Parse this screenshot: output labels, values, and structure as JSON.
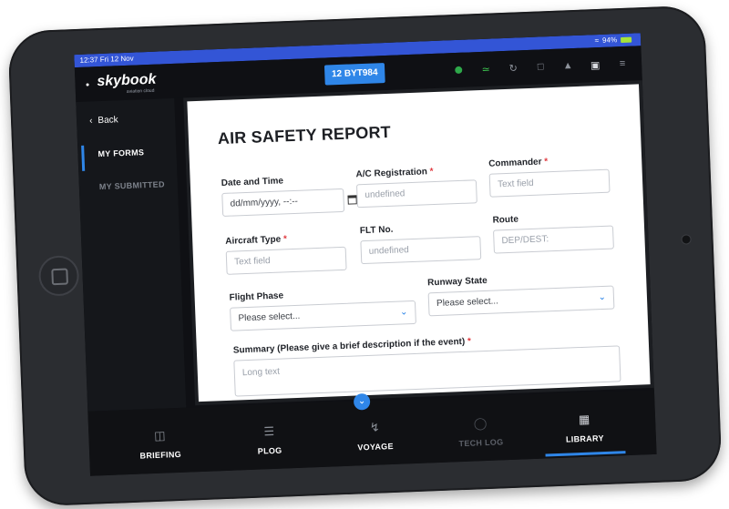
{
  "status_bar": {
    "time": "12:37",
    "date": "Fri 12 Nov",
    "battery": "94%"
  },
  "header": {
    "logo": "skybook",
    "logo_subtitle": "aviation cloud",
    "flight_button": "12 BYT984"
  },
  "sidebar": {
    "back_label": "Back",
    "items": [
      {
        "label": "MY FORMS",
        "active": true
      },
      {
        "label": "MY SUBMITTED",
        "active": false
      }
    ]
  },
  "form": {
    "title": "AIR SAFETY REPORT",
    "date_time": {
      "label": "Date and Time",
      "value": "dd/mm/yyyy, --:--"
    },
    "ac_registration": {
      "label": "A/C Registration",
      "required": "*",
      "value": "undefined"
    },
    "commander": {
      "label": "Commander",
      "required": "*",
      "placeholder": "Text field"
    },
    "aircraft_type": {
      "label": "Aircraft Type",
      "required": "*",
      "placeholder": "Text field"
    },
    "flt_no": {
      "label": "FLT No.",
      "value": "undefined"
    },
    "route": {
      "label": "Route",
      "placeholder": "DEP/DEST:"
    },
    "flight_phase": {
      "label": "Flight Phase",
      "value": "Please select..."
    },
    "runway_state": {
      "label": "Runway State",
      "value": "Please select..."
    },
    "summary": {
      "label": "Summary (Please give a brief description if the event)",
      "required": "*",
      "placeholder": "Long text"
    }
  },
  "bottom_nav": {
    "tabs": [
      {
        "label": "BRIEFING",
        "icon": "briefing-icon"
      },
      {
        "label": "PLOG",
        "icon": "checklist-icon"
      },
      {
        "label": "VOYAGE",
        "icon": "route-icon"
      },
      {
        "label": "TECH LOG",
        "icon": "engine-icon",
        "disabled": true
      },
      {
        "label": "LIBRARY",
        "icon": "library-icon",
        "active": true
      }
    ]
  },
  "colors": {
    "accent": "#2f86e8",
    "status_bar": "#3355d6",
    "required": "#e0383e"
  }
}
